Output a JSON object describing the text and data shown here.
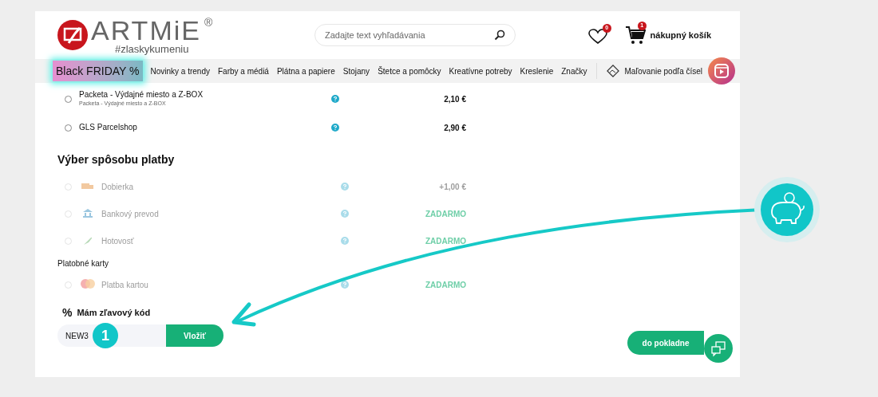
{
  "header": {
    "logo": "ARTMiE",
    "logo_mark": "®",
    "tagline": "#zlaskykumeniu",
    "search": {
      "placeholder": "Zadajte text vyhľadávania"
    },
    "wishlist_count": "0",
    "cart_count": "1",
    "cart_label": "nákupný košík"
  },
  "nav": [
    {
      "label": "Black FRIDAY %",
      "kind": "promo"
    },
    {
      "label": "Novinky a trendy",
      "kind": "link"
    },
    {
      "label": "Farby a médiá",
      "kind": "link"
    },
    {
      "label": "Plátna a papiere",
      "kind": "link"
    },
    {
      "label": "Stojany",
      "kind": "link"
    },
    {
      "label": "Štetce a pomôcky",
      "kind": "link"
    },
    {
      "label": "Kreatívne potreby",
      "kind": "link"
    },
    {
      "label": "Kreslenie",
      "kind": "link"
    },
    {
      "label": "Značky",
      "kind": "link"
    },
    {
      "label": "Maľovanie podľa čísel",
      "kind": "featured"
    }
  ],
  "shipping": [
    {
      "title": "Packeta - Výdajné miesto a Z-BOX",
      "subtitle": "Packeta - Výdajné miesto a Z-BOX",
      "price": "2,10 €",
      "selected": false
    },
    {
      "title": "GLS Parcelshop",
      "price": "2,90 €",
      "selected": false
    }
  ],
  "payment": {
    "title": "Výber spôsobu platby",
    "methods": [
      {
        "label": "Dobierka",
        "kind": "cod",
        "price": "+1,00 €",
        "free": false,
        "disabled": true
      },
      {
        "label": "Bankový prevod",
        "kind": "bank",
        "price": "ZADARMO",
        "free": true,
        "disabled": true
      },
      {
        "label": "Hotovosť",
        "kind": "cash",
        "price": "ZADARMO",
        "free": true,
        "disabled": true
      }
    ],
    "cards_label": "Platobné karty",
    "cards": [
      {
        "label": "Platba kartou",
        "kind": "card",
        "price": "ZADARMO",
        "free": true,
        "disabled": true
      }
    ]
  },
  "coupon": {
    "icon": "%",
    "label": "Mám zľavový kód",
    "value": "NEW3",
    "button": "Vložiť"
  },
  "step_badge": "1",
  "checkout_button": "do pokladne"
}
